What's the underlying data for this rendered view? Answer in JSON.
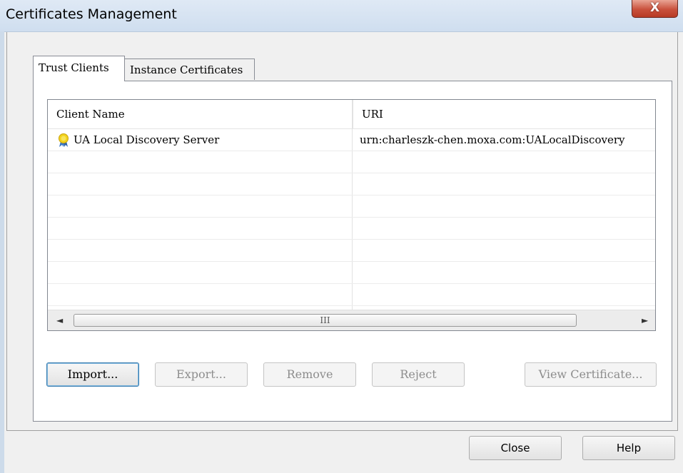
{
  "window": {
    "title": "Certificates Management",
    "close_glyph": "X"
  },
  "tabs": [
    {
      "label": "Trust Clients",
      "active": true
    },
    {
      "label": "Instance Certificates",
      "active": false
    }
  ],
  "list": {
    "columns": [
      "Client Name",
      "URI"
    ],
    "rows": [
      {
        "name": "UA Local Discovery Server",
        "uri": "urn:charleszk-chen.moxa.com:UALocalDiscovery",
        "icon": "certificate-icon"
      }
    ],
    "scrollbar": {
      "left_arrow": "◄",
      "right_arrow": "►",
      "grip": "III"
    }
  },
  "actions": {
    "import": "Import...",
    "export": "Export...",
    "remove": "Remove",
    "reject": "Reject",
    "view_certificate": "View Certificate..."
  },
  "footer": {
    "close": "Close",
    "help": "Help"
  },
  "colors": {
    "titlebar": "#cfdeef",
    "close_button": "#c9513c",
    "default_button_border": "#3c7fb1"
  }
}
